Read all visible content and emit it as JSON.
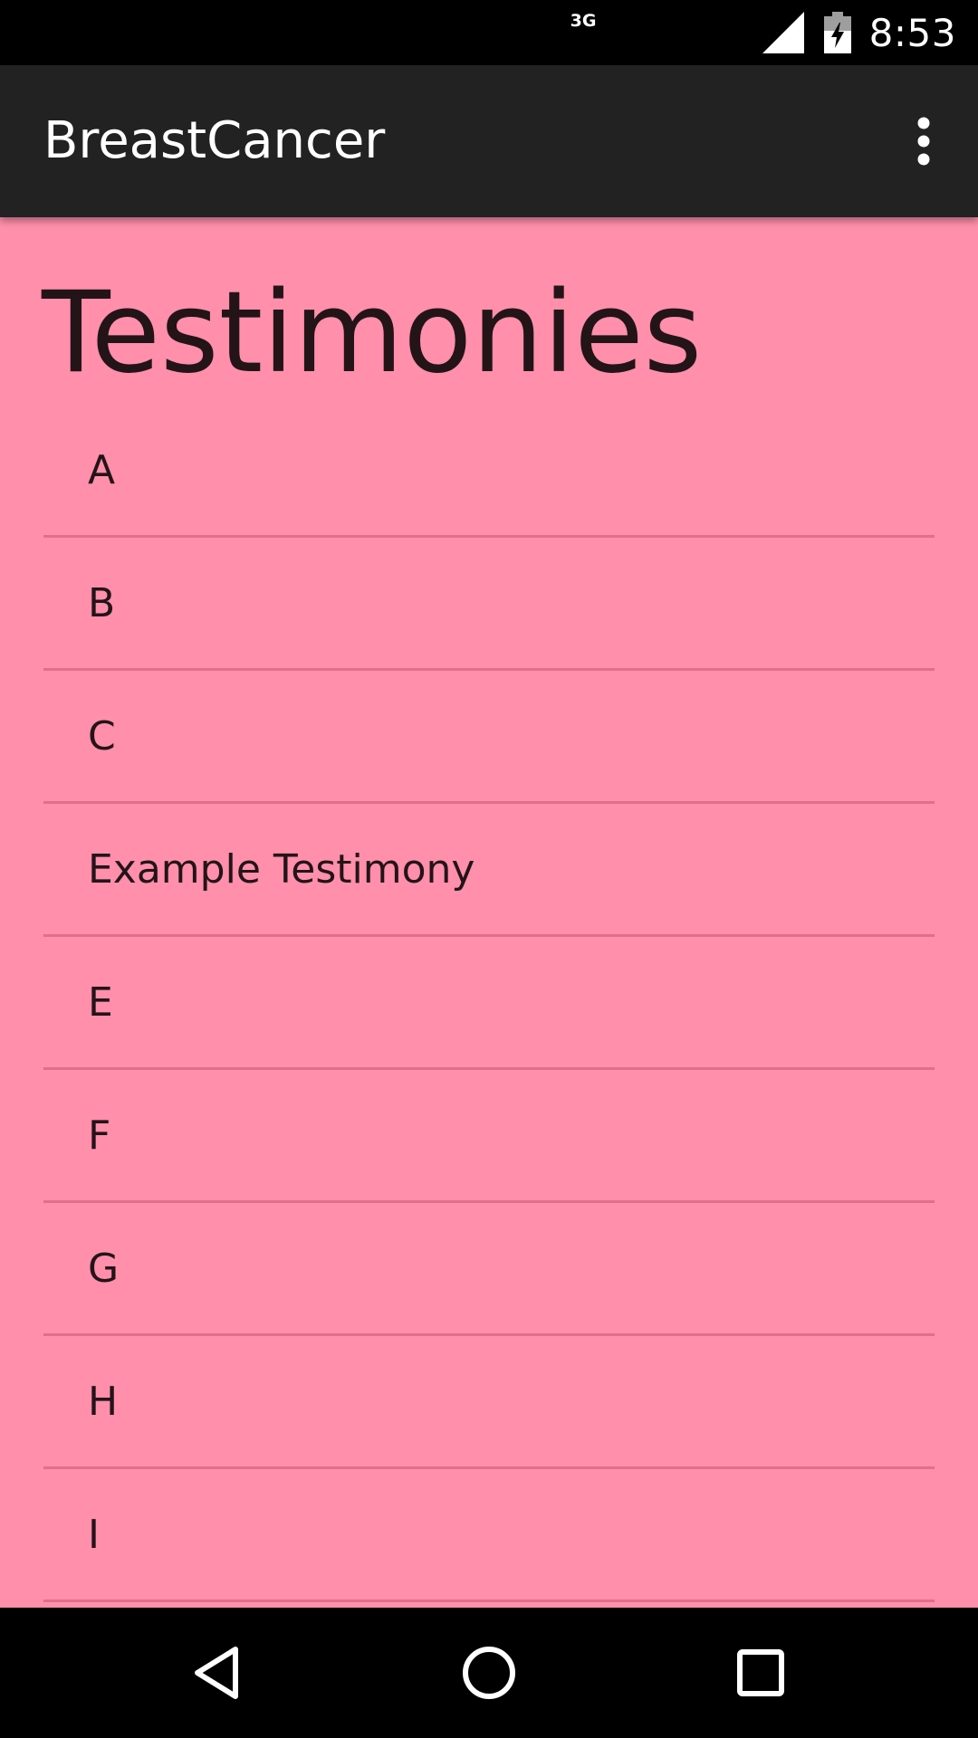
{
  "status_bar": {
    "network": "3G",
    "time": "8:53",
    "icons": [
      "signal-icon",
      "battery-charging-icon"
    ]
  },
  "app_bar": {
    "title": "BreastCancer",
    "overflow_icon": "more-vert-icon"
  },
  "content": {
    "background_color": "#ff8fab",
    "title": "Testimonies",
    "items": [
      {
        "label": "A"
      },
      {
        "label": "B"
      },
      {
        "label": "C"
      },
      {
        "label": "Example Testimony"
      },
      {
        "label": "E"
      },
      {
        "label": "F"
      },
      {
        "label": "G"
      },
      {
        "label": "H"
      },
      {
        "label": "I"
      }
    ]
  },
  "nav_bar": {
    "buttons": [
      "back-icon",
      "home-icon",
      "recents-icon"
    ]
  }
}
